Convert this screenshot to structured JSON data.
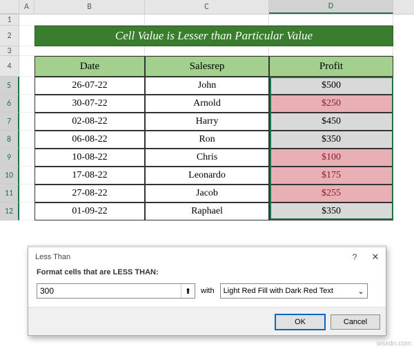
{
  "columns": [
    "A",
    "B",
    "C",
    "D"
  ],
  "row_numbers": [
    1,
    2,
    3,
    4,
    5,
    6,
    7,
    8,
    9,
    10,
    11,
    12
  ],
  "title": "Cell Value is Lesser than Particular Value",
  "headers": {
    "date": "Date",
    "salesrep": "Salesrep",
    "profit": "Profit"
  },
  "rows": [
    {
      "date": "26-07-22",
      "salesrep": "John",
      "profit": "$500",
      "red": false
    },
    {
      "date": "30-07-22",
      "salesrep": "Arnold",
      "profit": "$250",
      "red": true
    },
    {
      "date": "02-08-22",
      "salesrep": "Harry",
      "profit": "$450",
      "red": false
    },
    {
      "date": "06-08-22",
      "salesrep": "Ron",
      "profit": "$350",
      "red": false
    },
    {
      "date": "10-08-22",
      "salesrep": "Chris",
      "profit": "$100",
      "red": true
    },
    {
      "date": "17-08-22",
      "salesrep": "Leonardo",
      "profit": "$175",
      "red": true
    },
    {
      "date": "27-08-22",
      "salesrep": "Jacob",
      "profit": "$255",
      "red": true
    },
    {
      "date": "01-09-22",
      "salesrep": "Raphael",
      "profit": "$350",
      "red": false
    }
  ],
  "dialog": {
    "title": "Less Than",
    "label": "Format cells that are LESS THAN:",
    "value": "300",
    "with": "with",
    "format": "Light Red Fill with Dark Red Text",
    "ok": "OK",
    "cancel": "Cancel",
    "help_icon": "?",
    "close_icon": "✕",
    "dropdown_icon": "⌄",
    "collapse_icon": "⬆"
  },
  "watermark": "wsxdn.com",
  "colors": {
    "brand_green": "#3a7d2f",
    "header_green": "#a4d08f",
    "grey_fill": "#d9d9d9",
    "red_fill": "#e8b0b4",
    "red_text": "#8b1a2a"
  }
}
